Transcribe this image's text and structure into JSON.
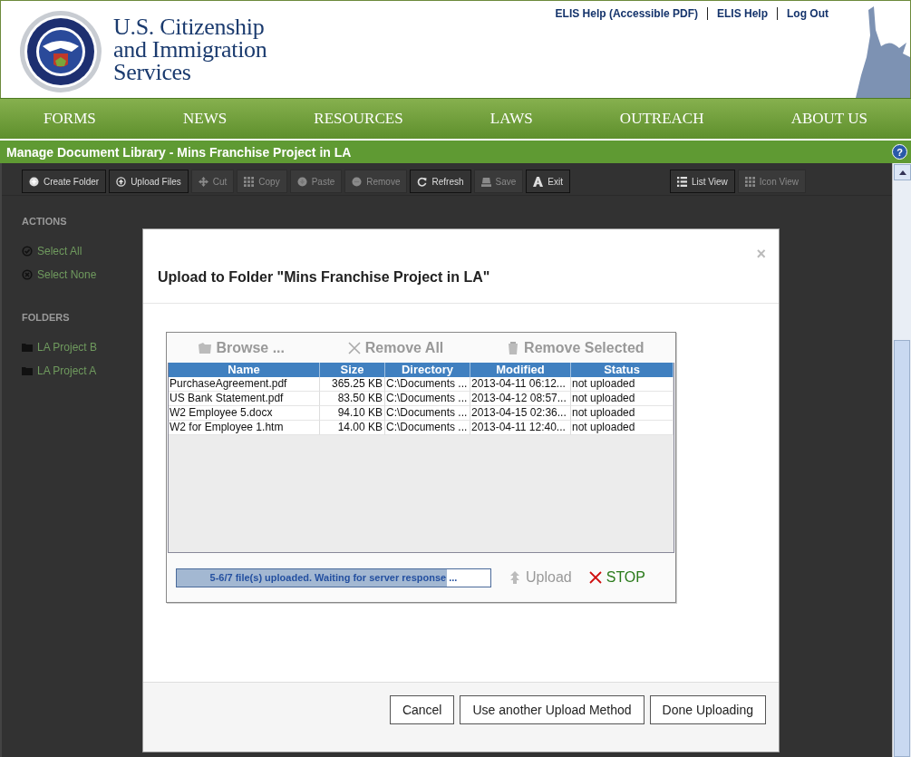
{
  "header": {
    "agency": [
      "U.S. Citizenship",
      "and Immigration",
      "Services"
    ],
    "links": [
      "ELIS Help (Accessible PDF)",
      "ELIS Help",
      "Log Out"
    ]
  },
  "nav": [
    "FORMS",
    "NEWS",
    "RESOURCES",
    "LAWS",
    "OUTREACH",
    "ABOUT US"
  ],
  "title_bar": {
    "title": "Manage Document Library - Mins Franchise Project in LA",
    "help": "?"
  },
  "toolbar": [
    {
      "label": "Create Folder",
      "disabled": false
    },
    {
      "label": "Upload Files",
      "disabled": false
    },
    {
      "label": "Cut",
      "disabled": true
    },
    {
      "label": "Copy",
      "disabled": true
    },
    {
      "label": "Paste",
      "disabled": true
    },
    {
      "label": "Remove",
      "disabled": true
    },
    {
      "label": "Refresh",
      "disabled": false
    },
    {
      "label": "Save",
      "disabled": true
    },
    {
      "label": "Exit",
      "disabled": false
    }
  ],
  "view_buttons": [
    {
      "label": "List View",
      "disabled": false
    },
    {
      "label": "Icon View",
      "disabled": true
    }
  ],
  "sidebar": {
    "actions_heading": "ACTIONS",
    "actions": [
      {
        "label": "Select All"
      },
      {
        "label": "Select None"
      }
    ],
    "folders_heading": "FOLDERS",
    "folders": [
      "LA Project B",
      "LA Project A"
    ]
  },
  "dialog": {
    "title": "Upload to Folder \"Mins Franchise Project in LA\"",
    "close": "×",
    "uploader": {
      "actions": [
        "Browse ...",
        "Remove All",
        "Remove Selected"
      ],
      "columns": [
        "Name",
        "Size",
        "Directory",
        "Modified",
        "Status"
      ],
      "rows": [
        [
          "PurchaseAgreement.pdf",
          "365.25 KB",
          "C:\\Documents ...",
          "2013-04-11 06:12...",
          "not uploaded"
        ],
        [
          "US Bank Statement.pdf",
          "83.50 KB",
          "C:\\Documents ...",
          "2013-04-12 08:57...",
          "not uploaded"
        ],
        [
          "W2 Employee 5.docx",
          "94.10 KB",
          "C:\\Documents ...",
          "2013-04-15 02:36...",
          "not uploaded"
        ],
        [
          "W2 for Employee 1.htm",
          "14.00 KB",
          "C:\\Documents ...",
          "2013-04-11 12:40...",
          "not uploaded"
        ]
      ],
      "progress": {
        "text": "5-6/7 file(s) uploaded. Waiting for server response ...",
        "level": 0.86
      },
      "upload": {
        "label": "Upload",
        "disabled": true
      },
      "stop": "STOP"
    },
    "buttons": [
      "Cancel",
      "Use another Upload Method",
      "Done Uploading"
    ]
  }
}
